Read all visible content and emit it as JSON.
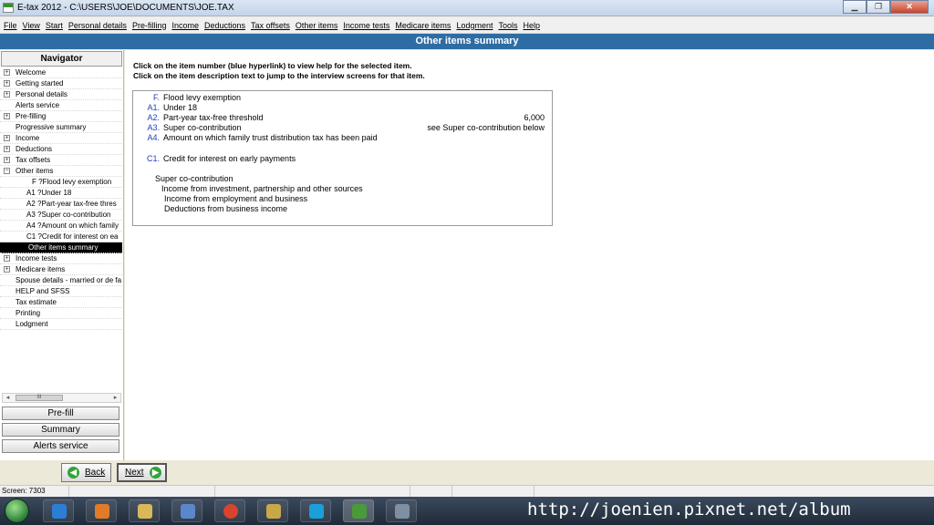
{
  "window": {
    "title": "E-tax 2012 - C:\\USERS\\JOE\\DOCUMENTS\\JOE.TAX"
  },
  "menu": [
    "File",
    "View",
    "Start",
    "Personal details",
    "Pre-filling",
    "Income",
    "Deductions",
    "Tax offsets",
    "Other items",
    "Income tests",
    "Medicare items",
    "Lodgment",
    "Tools",
    "Help"
  ],
  "header": {
    "title": "Other items summary"
  },
  "navigator": {
    "title": "Navigator",
    "items": [
      {
        "label": "Welcome",
        "expander": "+"
      },
      {
        "label": "Getting started",
        "expander": "+"
      },
      {
        "label": "Personal details",
        "expander": "+"
      },
      {
        "label": "Alerts service",
        "expander": ""
      },
      {
        "label": "Pre-filling",
        "expander": "+"
      },
      {
        "label": "Progressive summary",
        "expander": ""
      },
      {
        "label": "Income",
        "expander": "+"
      },
      {
        "label": "Deductions",
        "expander": "+"
      },
      {
        "label": "Tax offsets",
        "expander": "+"
      },
      {
        "label": "Other items",
        "expander": "−"
      },
      {
        "label": "F ?Flood levy exemption",
        "expander": "",
        "level": 2
      },
      {
        "label": "A1 ?Under 18",
        "expander": "",
        "level": 1
      },
      {
        "label": "A2 ?Part-year tax-free thres",
        "expander": "",
        "level": 1
      },
      {
        "label": "A3 ?Super co-contribution",
        "expander": "",
        "level": 1
      },
      {
        "label": "A4 ?Amount on which family",
        "expander": "",
        "level": 1
      },
      {
        "label": "C1 ?Credit for interest on ea",
        "expander": "",
        "level": 1
      },
      {
        "label": "Other items summary",
        "expander": "",
        "selected": true
      },
      {
        "label": "Income tests",
        "expander": "+"
      },
      {
        "label": "Medicare items",
        "expander": "+"
      },
      {
        "label": "Spouse details - married or de fa",
        "expander": ""
      },
      {
        "label": "HELP and SFSS",
        "expander": ""
      },
      {
        "label": "Tax estimate",
        "expander": ""
      },
      {
        "label": "Printing",
        "expander": ""
      },
      {
        "label": "Lodgment",
        "expander": ""
      }
    ],
    "scroll_thumb": "III",
    "buttons": {
      "prefill": "Pre-fill",
      "summary": "Summary",
      "alerts": "Alerts service"
    }
  },
  "instructions": {
    "line1": "Click on the item number (blue hyperlink) to view help for the selected item.",
    "line2": "Click on the item description text to jump to the interview screens for that item."
  },
  "summary_items": [
    {
      "code": "F.",
      "desc": "Flood levy exemption",
      "value": ""
    },
    {
      "code": "A1.",
      "desc": "Under 18",
      "value": ""
    },
    {
      "code": "A2.",
      "desc": "Part-year tax-free threshold",
      "value": "6,000"
    },
    {
      "code": "A3.",
      "desc": "Super co-contribution",
      "value": "see Super co-contribution below"
    },
    {
      "code": "A4.",
      "desc": "Amount on which family trust distribution tax has been paid",
      "value": ""
    },
    {
      "code": "C1.",
      "desc": "Credit for interest on early payments",
      "value": ""
    }
  ],
  "super_section": {
    "title": "Super co-contribution",
    "lines": [
      "Income from investment, partnership and other sources",
      "Income from employment and business",
      "Deductions from business income"
    ]
  },
  "bottom": {
    "back": "Back",
    "next": "Next"
  },
  "status": {
    "screen": "Screen: 7303"
  },
  "watermark": "http://joenien.pixnet.net/album",
  "colors": {
    "header": "#2e6da4",
    "link": "#1f3fbf",
    "selected": "#000000"
  }
}
